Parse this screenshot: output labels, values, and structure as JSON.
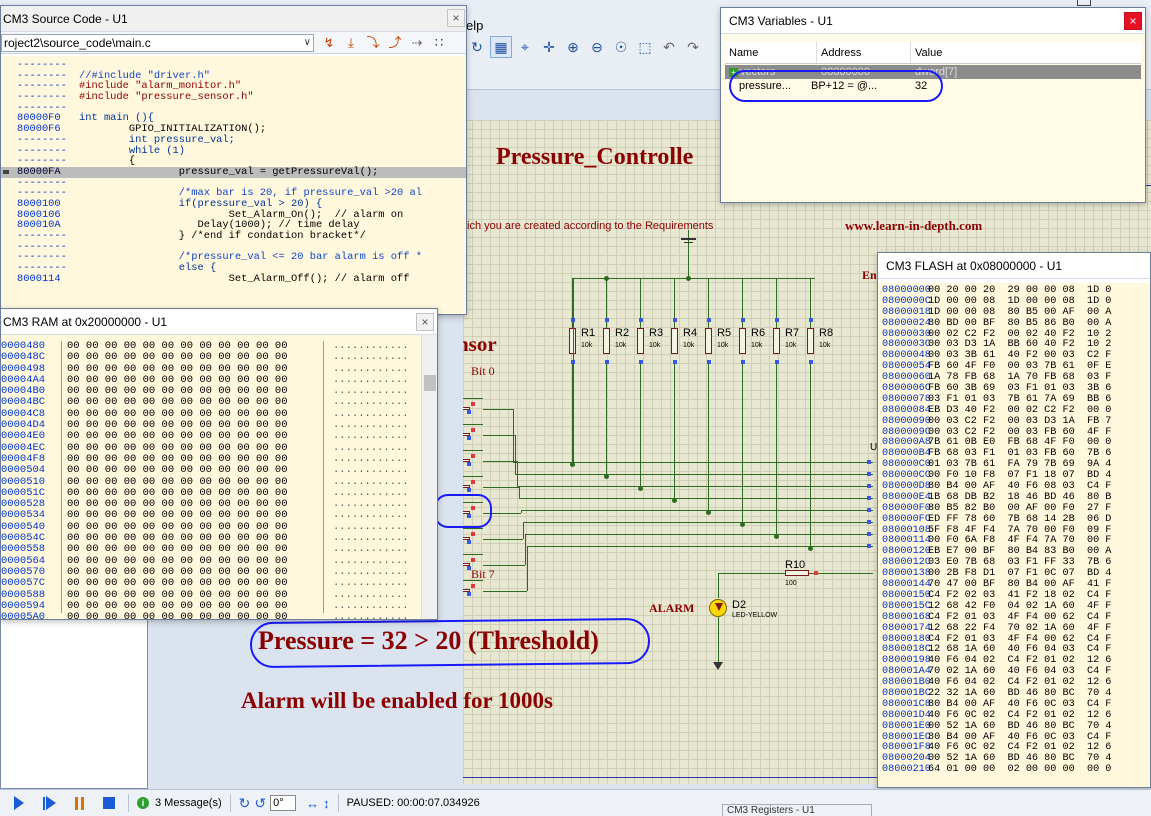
{
  "app": {
    "menu_help": "elp",
    "toolbar_icons": [
      "refresh-icon",
      "grid-icon",
      "origin-icon",
      "pan-icon",
      "zoom-in-icon",
      "zoom-out-icon",
      "zoom-all-icon",
      "zoom-area-icon",
      "undo-icon",
      "redo-icon"
    ]
  },
  "source_window": {
    "title": "CM3 Source Code - U1",
    "file_path": "roject2\\source_code\\main.c",
    "lines": [
      {
        "addr": "--------",
        "text": ""
      },
      {
        "addr": "--------",
        "text": "//#include \"driver.h\"",
        "kind": "cm"
      },
      {
        "addr": "--------",
        "text": "#include \"alarm_monitor.h\"",
        "kind": "pp"
      },
      {
        "addr": "--------",
        "text": "#include \"pressure_sensor.h\"",
        "kind": "pp"
      },
      {
        "addr": "--------",
        "text": ""
      },
      {
        "addr": "80000F0",
        "text": "int main (){",
        "kind": "kw"
      },
      {
        "addr": "80000F6",
        "text": "        GPIO_INITIALIZATION();",
        "kind": "plain"
      },
      {
        "addr": "--------",
        "text": "        int pressure_val;",
        "kind": "kw"
      },
      {
        "addr": "--------",
        "text": "        while (1)",
        "kind": "kw"
      },
      {
        "addr": "--------",
        "text": "        {",
        "kind": "plain"
      },
      {
        "addr": "80000FA",
        "text": "                pressure_val = getPressureVal();",
        "kind": "plain",
        "hl": true
      },
      {
        "addr": "--------",
        "text": ""
      },
      {
        "addr": "--------",
        "text": "                /*max bar is 20, if pressure_val >20 al",
        "kind": "cm"
      },
      {
        "addr": "8000100",
        "text": "                if(pressure_val > 20) {",
        "kind": "kw"
      },
      {
        "addr": "8000106",
        "text": "                        Set_Alarm_On();  // alarm on",
        "kind": "plain"
      },
      {
        "addr": "800010A",
        "text": "                   Delay(1000); // time delay",
        "kind": "plain"
      },
      {
        "addr": "--------",
        "text": "                } /*end if condation bracket*/",
        "kind": "plain"
      },
      {
        "addr": "--------",
        "text": ""
      },
      {
        "addr": "--------",
        "text": "                /*pressure_val <= 20 bar alarm is off *",
        "kind": "cm"
      },
      {
        "addr": "--------",
        "text": "                else {",
        "kind": "kw"
      },
      {
        "addr": "8000114",
        "text": "                        Set_Alarm_Off(); // alarm off",
        "kind": "plain"
      }
    ]
  },
  "ram_window": {
    "title": "CM3 RAM at 0x20000000 - U1",
    "rows": [
      {
        "addr": "0000480",
        "hex": "00 00 00 00 00 00 00 00 00 00 00 00",
        "chars": "............"
      },
      {
        "addr": "000048C",
        "hex": "00 00 00 00 00 00 00 00 00 00 00 00",
        "chars": "............"
      },
      {
        "addr": "0000498",
        "hex": "00 00 00 00 00 00 00 00 00 00 00 00",
        "chars": "............"
      },
      {
        "addr": "00004A4",
        "hex": "00 00 00 00 00 00 00 00 00 00 00 00",
        "chars": "............"
      },
      {
        "addr": "00004B0",
        "hex": "00 00 00 00 00 00 00 00 00 00 00 00",
        "chars": "............"
      },
      {
        "addr": "00004BC",
        "hex": "00 00 00 00 00 00 00 00 00 00 00 00",
        "chars": "............"
      },
      {
        "addr": "00004C8",
        "hex": "00 00 00 00 00 00 00 00 00 00 00 00",
        "chars": "............"
      },
      {
        "addr": "00004D4",
        "hex": "00 00 00 00 00 00 00 00 00 00 00 00",
        "chars": "............"
      },
      {
        "addr": "00004E0",
        "hex": "00 00 00 00 00 00 00 00 00 00 00 00",
        "chars": "............"
      },
      {
        "addr": "00004EC",
        "hex": "00 00 00 00 00 00 00 00 00 00 00 00",
        "chars": "............"
      },
      {
        "addr": "00004F8",
        "hex": "00 00 00 00 00 00 00 00 00 00 00 00",
        "chars": "............"
      },
      {
        "addr": "0000504",
        "hex": "00 00 00 00 00 00 00 00 00 00 00 00",
        "chars": "............"
      },
      {
        "addr": "0000510",
        "hex": "00 00 00 00 00 00 00 00 00 00 00 00",
        "chars": "............"
      },
      {
        "addr": "000051C",
        "hex": "00 00 00 00 00 00 00 00 00 00 00 00",
        "chars": "............"
      },
      {
        "addr": "0000528",
        "hex": "00 00 00 00 00 00 00 00 00 00 00 00",
        "chars": "............"
      },
      {
        "addr": "0000534",
        "hex": "00 00 00 00 00 00 00 00 00 00 00 00",
        "chars": "............"
      },
      {
        "addr": "0000540",
        "hex": "00 00 00 00 00 00 00 00 00 00 00 00",
        "chars": "............"
      },
      {
        "addr": "000054C",
        "hex": "00 00 00 00 00 00 00 00 00 00 00 00",
        "chars": "............"
      },
      {
        "addr": "0000558",
        "hex": "00 00 00 00 00 00 00 00 00 00 00 00",
        "chars": "............"
      },
      {
        "addr": "0000564",
        "hex": "00 00 00 00 00 00 00 00 00 00 00 00",
        "chars": "............"
      },
      {
        "addr": "0000570",
        "hex": "00 00 00 00 00 00 00 00 00 00 00 00",
        "chars": "............"
      },
      {
        "addr": "000057C",
        "hex": "00 00 00 00 00 00 00 00 00 00 00 00",
        "chars": "............"
      },
      {
        "addr": "0000588",
        "hex": "00 00 00 00 00 00 00 00 00 00 00 00",
        "chars": "............"
      },
      {
        "addr": "0000594",
        "hex": "00 00 00 00 00 00 00 00 00 00 00 00",
        "chars": "............"
      },
      {
        "addr": "00005A0",
        "hex": "00 00 00 00 00 00 00 00 00 00 00 00",
        "chars": "............"
      }
    ]
  },
  "vars_window": {
    "title": "CM3 Variables - U1",
    "col_name": "Name",
    "col_address": "Address",
    "col_value": "Value",
    "rows": [
      {
        "name": "vectors",
        "address": "08000000",
        "value": "dword[7]",
        "selected": true,
        "expand": "+"
      },
      {
        "name": "pressure...",
        "address": "BP+12 = @...",
        "value": "32"
      }
    ]
  },
  "flash_window": {
    "title": "CM3 FLASH at 0x08000000 - U1",
    "rows": [
      {
        "addr": "08000000",
        "hex": "00 20 00 20  29 00 00 08  1D 0"
      },
      {
        "addr": "0800000C",
        "hex": "1D 00 00 08  1D 00 00 08  1D 0"
      },
      {
        "addr": "08000018",
        "hex": "1D 00 00 08  80 B5 00 AF  00 A"
      },
      {
        "addr": "08000024",
        "hex": "80 BD 00 BF  80 B5 86 B0  00 A"
      },
      {
        "addr": "08000030",
        "hex": "00 02 C2 F2  00 02 40 F2  10 2"
      },
      {
        "addr": "0800003C",
        "hex": "00 03 D3 1A  BB 60 40 F2  10 2"
      },
      {
        "addr": "08000048",
        "hex": "00 03 3B 61  40 F2 00 03  C2 F"
      },
      {
        "addr": "08000054",
        "hex": "FB 60 4F F0  00 03 7B 61  0F E"
      },
      {
        "addr": "08000060",
        "hex": "1A 78 FB 68  1A 70 FB 68  03 F"
      },
      {
        "addr": "0800006C",
        "hex": "FB 60 3B 69  03 F1 01 03  3B 6"
      },
      {
        "addr": "08000078",
        "hex": "03 F1 01 03  7B 61 7A 69  BB 6"
      },
      {
        "addr": "08000084",
        "hex": "EB D3 40 F2  00 02 C2 F2  00 0"
      },
      {
        "addr": "08000090",
        "hex": "00 03 C2 F2  00 03 D3 1A  FB 7"
      },
      {
        "addr": "0800009C",
        "hex": "00 03 C2 F2  00 03 FB 60  4F F"
      },
      {
        "addr": "080000A8",
        "hex": "7B 61 0B E0  FB 68 4F F0  00 0"
      },
      {
        "addr": "080000B4",
        "hex": "FB 68 03 F1  01 03 FB 60  7B 6"
      },
      {
        "addr": "080000C0",
        "hex": "01 03 7B 61  FA 79 7B 69  9A 4"
      },
      {
        "addr": "080000CC",
        "hex": "00 F0 10 F8  07 F1 18 07  BD 4"
      },
      {
        "addr": "080000D8",
        "hex": "80 B4 00 AF  40 F6 08 03  C4 F"
      },
      {
        "addr": "080000E4",
        "hex": "1B 68 DB B2  18 46 BD 46  80 B"
      },
      {
        "addr": "080000F0",
        "hex": "80 B5 82 B0  00 AF 00 F0  27 F"
      },
      {
        "addr": "080000FC",
        "hex": "ED FF 78 60  7B 68 14 2B  06 D"
      },
      {
        "addr": "08000108",
        "hex": "5F F8 4F F4  7A 70 00 F0  09 F"
      },
      {
        "addr": "08000114",
        "hex": "00 F0 6A F8  4F F4 7A 70  00 F"
      },
      {
        "addr": "08000120",
        "hex": "EB E7 00 BF  80 B4 83 B0  00 A"
      },
      {
        "addr": "0800012C",
        "hex": "03 E0 7B 68  03 F1 FF 33  7B 6"
      },
      {
        "addr": "08000138",
        "hex": "00 2B F8 D1  07 F1 0C 07  BD 4"
      },
      {
        "addr": "08000144",
        "hex": "70 47 00 BF  80 B4 00 AF  41 F"
      },
      {
        "addr": "08000150",
        "hex": "C4 F2 02 03  41 F2 18 02  C4 F"
      },
      {
        "addr": "0800015C",
        "hex": "12 68 42 F0  04 02 1A 60  4F F"
      },
      {
        "addr": "08000168",
        "hex": "C4 F2 01 03  4F F4 00 62  C4 F"
      },
      {
        "addr": "08000174",
        "hex": "12 68 22 F4  70 02 1A 60  4F F"
      },
      {
        "addr": "08000180",
        "hex": "C4 F2 01 03  4F F4 00 62  C4 F"
      },
      {
        "addr": "0800018C",
        "hex": "12 68 1A 60  40 F6 04 03  C4 F"
      },
      {
        "addr": "08000198",
        "hex": "40 F6 04 02  C4 F2 01 02  12 6"
      },
      {
        "addr": "080001A4",
        "hex": "70 02 1A 60  40 F6 04 03  C4 F"
      },
      {
        "addr": "080001B0",
        "hex": "40 F6 04 02  C4 F2 01 02  12 6"
      },
      {
        "addr": "080001BC",
        "hex": "22 32 1A 60  BD 46 80 BC  70 4"
      },
      {
        "addr": "080001C8",
        "hex": "80 B4 00 AF  40 F6 0C 03  C4 F"
      },
      {
        "addr": "080001D4",
        "hex": "40 F6 0C 02  C4 F2 01 02  12 6"
      },
      {
        "addr": "080001E0",
        "hex": "00 52 1A 60  BD 46 80 BC  70 4"
      },
      {
        "addr": "080001EC",
        "hex": "80 B4 00 AF  40 F6 0C 03  C4 F"
      },
      {
        "addr": "080001F8",
        "hex": "40 F6 0C 02  C4 F2 01 02  12 6"
      },
      {
        "addr": "08000204",
        "hex": "00 52 1A 60  BD 46 80 BC  70 4"
      },
      {
        "addr": "08000210",
        "hex": "64 01 00 00  02 00 00 00  00 0"
      }
    ]
  },
  "schematic": {
    "title": "Pressure_Controlle",
    "subtitle": "ich you are created according to the Requirements",
    "website": "www.learn-in-depth.com",
    "sensor_label": "nsor",
    "bit0_label": "Bit 0",
    "bit7_label": "Bit 7",
    "resistors": [
      {
        "label": "R1",
        "value": "10k"
      },
      {
        "label": "R2",
        "value": "10k"
      },
      {
        "label": "R3",
        "value": "10k"
      },
      {
        "label": "R4",
        "value": "10k"
      },
      {
        "label": "R5",
        "value": "10k"
      },
      {
        "label": "R6",
        "value": "10k"
      },
      {
        "label": "R7",
        "value": "10k"
      },
      {
        "label": "R8",
        "value": "10k"
      }
    ],
    "r10_label": "R10",
    "r10_value": "100",
    "alarm_label": "ALARM",
    "led_label": "D2",
    "led_type": "LED-YELLOW",
    "pressure_equation": "Pressure = 32 > 20 (Threshold)",
    "alarm_note": "Alarm will  be enabled for 1000s",
    "extra_label": "En"
  },
  "status_bar": {
    "messages": "3 Message(s)",
    "zoom_value": "0°",
    "status_text": "PAUSED: 00:00:07.034926",
    "registers_peek": "CM3 Registers - U1"
  },
  "colors": {
    "accent_blue": "#1a5bd6",
    "pcb_red": "#8b0000",
    "wire_green": "#2e6b1f",
    "annotation_blue": "#1a1aff"
  }
}
